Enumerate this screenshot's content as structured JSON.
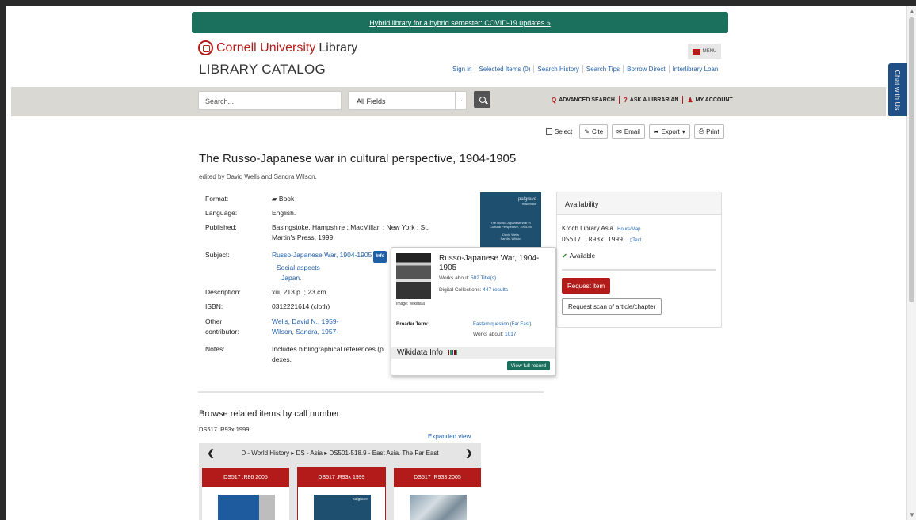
{
  "banner": {
    "text": "Hybrid library for a hybrid semester: COVID-19 updates »"
  },
  "header": {
    "logo_cornell": "Cornell University",
    "logo_library": "Library",
    "catalog_title": "LIBRARY CATALOG",
    "menu_label": "MENU",
    "links": [
      "Sign in",
      "Selected Items (0)",
      "Search History",
      "Search Tips",
      "Borrow Direct",
      "Interlibrary Loan"
    ]
  },
  "search": {
    "placeholder": "Search...",
    "field_value": "All Fields",
    "advanced": "ADVANCED SEARCH",
    "ask": "ASK A LIBRARIAN",
    "account": "MY ACCOUNT"
  },
  "chat_label": "Chat with Us",
  "tools": {
    "select": "Select",
    "cite": "Cite",
    "email": "Email",
    "export": "Export",
    "print": "Print"
  },
  "record": {
    "title": "The Russo-Japanese war in cultural perspective, 1904-1905",
    "byline": "edited by David Wells and Sandra Wilson.",
    "labels": {
      "format": "Format:",
      "language": "Language:",
      "published": "Published:",
      "subject": "Subject:",
      "description": "Description:",
      "isbn": "ISBN:",
      "other1": "Other",
      "other2": "contributor:",
      "notes": "Notes:"
    },
    "format": "Book",
    "language": "English.",
    "published_1": "Basingstoke, Hampshire : MacMillan ; New York : St.",
    "published_2": "Martin's Press, 1999.",
    "subject_1": "Russo-Japanese War, 1904-1905",
    "subject_info": "Info",
    "subject_2": "Social aspects",
    "subject_3": "Japan.",
    "description": "xiii, 213 p. ; 23 cm.",
    "isbn": "0312221614 (cloth)",
    "contributor_1": "Wells, David N., 1959-",
    "contributor_2": "Wilson, Sandra, 1957-",
    "notes_1": "Includes bibliographical references (p.",
    "notes_2": "dexes."
  },
  "cover": {
    "publisher_1": "palgrave",
    "publisher_2": "macmillan",
    "title": "The Russo-Japanese War in Cultural Perspective, 1904-05",
    "editors_1": "David Wells",
    "editors_2": "Sandra Wilson"
  },
  "availability": {
    "heading": "Availability",
    "location": "Kroch Library Asia",
    "hours": "Hours/Map",
    "callno": "DS517 .R93x 1999",
    "text_link": "Text",
    "status": "Available",
    "request": "Request item",
    "scan": "Request scan of article/chapter"
  },
  "popup": {
    "title": "Russo-Japanese War, 1904-1905",
    "works_about_label": "Works about:",
    "works_about_value": "502 Title(s)",
    "digital_label": "Digital Collections:",
    "digital_value": "447 results",
    "image_caption": "Image: Wikidata",
    "broader_label": "Broader Term:",
    "broader_value": "Eastern question (Far East)",
    "broader_works_label": "Works about:",
    "broader_works_value": "1017",
    "wikidata": "Wikidata Info",
    "view_full": "View full record"
  },
  "browse": {
    "title": "Browse related items by call number",
    "callno": "DS517 .R93x 1999",
    "expanded": "Expanded view",
    "breadcrumb": "D - World History ▸ DS - Asia ▸ DS501-518.9 - East Asia. The Far East",
    "cards": [
      "DS517 .R86 2005",
      "DS517 .R93x 1999",
      "DS517 .R933 2005"
    ],
    "card2_pub": "palgrave"
  },
  "colors": {
    "cornell_red": "#b31b1b",
    "banner_green": "#1a6f5d",
    "link_blue": "#1f5fa8"
  }
}
